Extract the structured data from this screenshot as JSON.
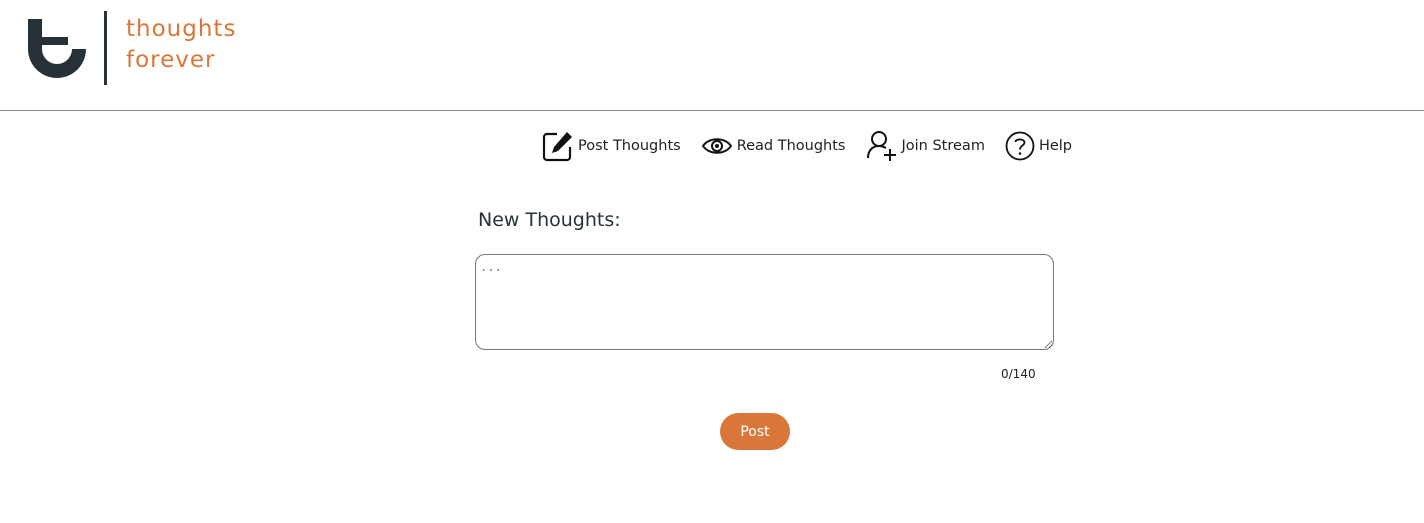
{
  "brand": {
    "line1": "thoughts",
    "line2": "forever",
    "accent_color": "#d9773a",
    "mark_color": "#263238"
  },
  "nav": {
    "items": [
      {
        "label": "Post Thoughts",
        "icon": "pencil-square-icon"
      },
      {
        "label": "Read Thoughts",
        "icon": "eye-icon"
      },
      {
        "label": "Join Stream",
        "icon": "user-plus-icon"
      },
      {
        "label": "Help",
        "icon": "question-circle-icon"
      }
    ]
  },
  "form": {
    "title": "New Thoughts:",
    "placeholder": "...",
    "value": "",
    "counter": "0/140",
    "post_label": "Post"
  }
}
